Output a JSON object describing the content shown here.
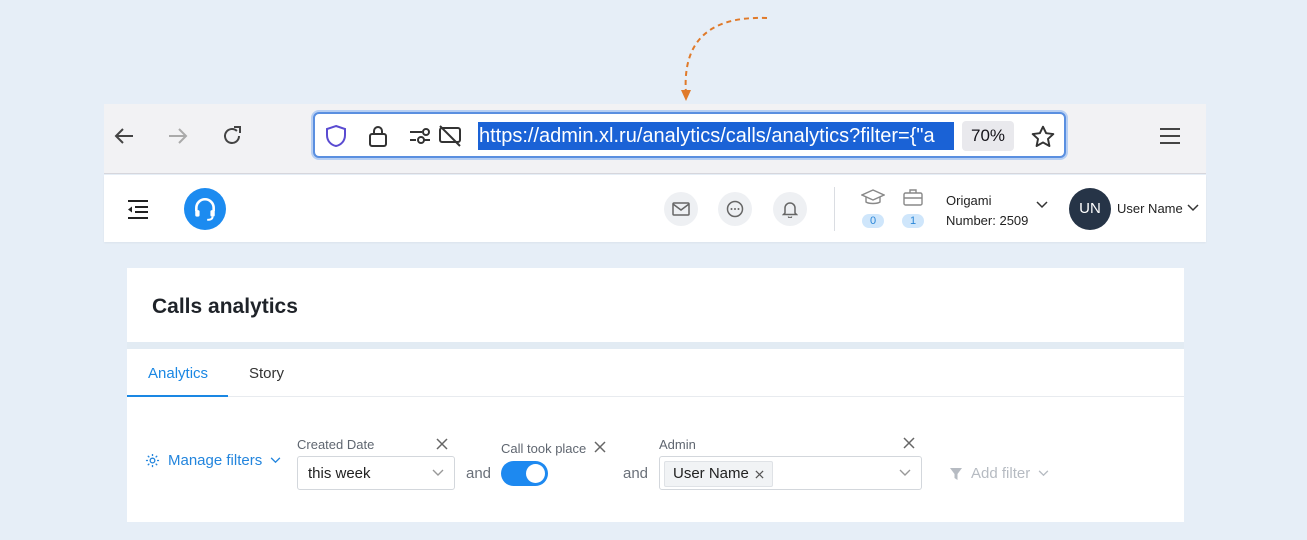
{
  "browser": {
    "url": "https://admin.xl.ru/analytics/calls/analytics?filter={\"a",
    "zoom": "70%"
  },
  "header": {
    "org_name": "Origami",
    "org_number": "Number: 2509",
    "badges": [
      "0",
      "1"
    ],
    "avatar_initials": "UN",
    "user_name": "User Name"
  },
  "page": {
    "title": "Calls analytics",
    "tabs": [
      {
        "label": "Analytics",
        "active": true
      },
      {
        "label": "Story",
        "active": false
      }
    ]
  },
  "filters": {
    "manage_label": "Manage filters",
    "created_date": {
      "label": "Created Date",
      "value": "this week"
    },
    "and_1": "and",
    "call_took_place": {
      "label": "Call took place",
      "on": true
    },
    "and_2": "and",
    "admin": {
      "label": "Admin",
      "chip": "User Name"
    },
    "add_filter": "Add filter"
  },
  "colors": {
    "accent": "#1a87e3",
    "avatar_bg": "#263447",
    "url_highlight": "#1a62d6",
    "annotation_arrow": "#e07a2a"
  },
  "icons": [
    "back-arrow-icon",
    "forward-arrow-icon",
    "reload-icon",
    "shield-icon",
    "lock-icon",
    "permissions-icon",
    "no-screen-share-icon",
    "star-icon",
    "hamburger-menu-icon",
    "sidebar-toggle-icon",
    "headset-icon",
    "mail-icon",
    "chat-icon",
    "bell-icon",
    "graduation-cap-icon",
    "briefcase-icon",
    "chevron-down-icon",
    "gear-icon",
    "funnel-icon",
    "close-icon"
  ]
}
